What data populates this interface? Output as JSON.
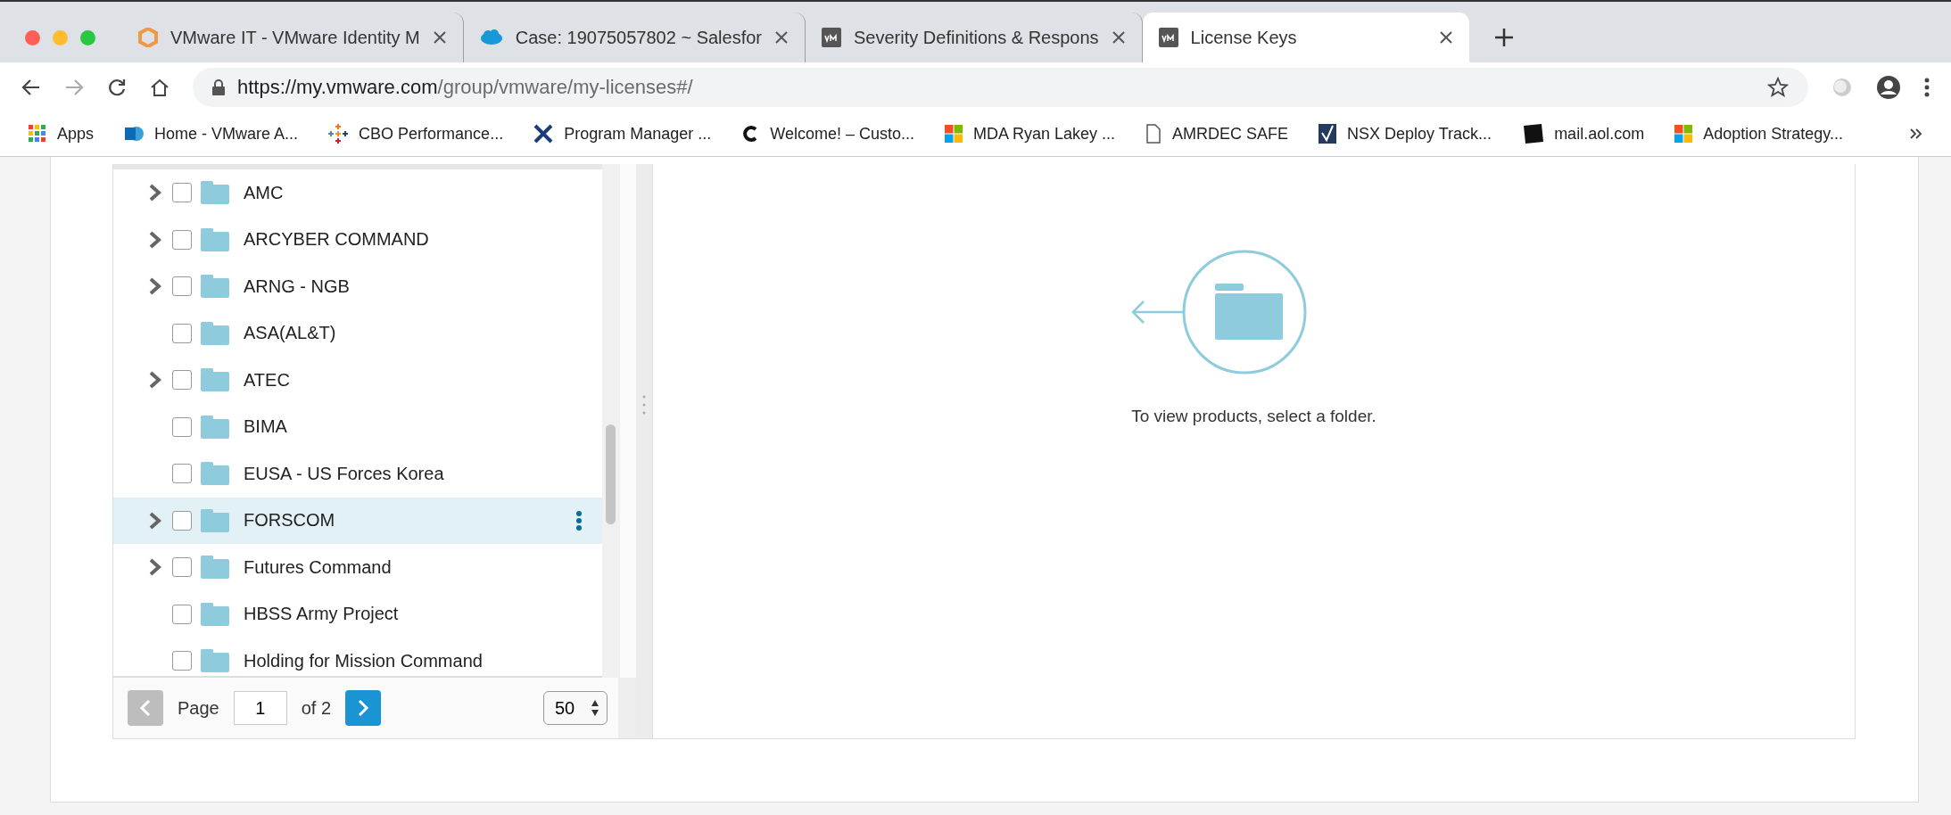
{
  "tabs": [
    {
      "title": "VMware IT - VMware Identity M",
      "selected": false
    },
    {
      "title": "Case: 19075057802 ~ Salesfor",
      "selected": false
    },
    {
      "title": "Severity Definitions & Respons",
      "selected": false
    },
    {
      "title": "License Keys",
      "selected": true
    }
  ],
  "address_bar": {
    "host": "https://my.vmware.com",
    "path": "/group/vmware/my-licenses#/"
  },
  "bookmarks": [
    {
      "label": "Apps"
    },
    {
      "label": "Home - VMware A..."
    },
    {
      "label": "CBO Performance..."
    },
    {
      "label": "Program Manager ..."
    },
    {
      "label": "Welcome! – Custo..."
    },
    {
      "label": "MDA Ryan Lakey ..."
    },
    {
      "label": "AMRDEC SAFE"
    },
    {
      "label": "NSX Deploy Track..."
    },
    {
      "label": "mail.aol.com"
    },
    {
      "label": "Adoption Strategy..."
    }
  ],
  "folder_tree": [
    {
      "label": "AMC",
      "expandable": true,
      "checked": false,
      "selected": false
    },
    {
      "label": "ARCYBER COMMAND",
      "expandable": true,
      "checked": false,
      "selected": false
    },
    {
      "label": "ARNG - NGB",
      "expandable": true,
      "checked": false,
      "selected": false
    },
    {
      "label": "ASA(AL&T)",
      "expandable": false,
      "checked": false,
      "selected": false
    },
    {
      "label": "ATEC",
      "expandable": true,
      "checked": false,
      "selected": false
    },
    {
      "label": "BIMA",
      "expandable": false,
      "checked": false,
      "selected": false
    },
    {
      "label": "EUSA - US Forces Korea",
      "expandable": false,
      "checked": false,
      "selected": false
    },
    {
      "label": "FORSCOM",
      "expandable": true,
      "checked": false,
      "selected": true
    },
    {
      "label": "Futures Command",
      "expandable": true,
      "checked": false,
      "selected": false
    },
    {
      "label": "HBSS Army Project",
      "expandable": false,
      "checked": false,
      "selected": false
    },
    {
      "label": "Holding for Mission Command",
      "expandable": false,
      "checked": false,
      "selected": false
    }
  ],
  "pagination": {
    "label": "Page",
    "page": "1",
    "of": "of 2",
    "prev_disabled": true,
    "next_disabled": false,
    "page_size": "50"
  },
  "empty_state": {
    "message": "To view products, select a folder."
  }
}
